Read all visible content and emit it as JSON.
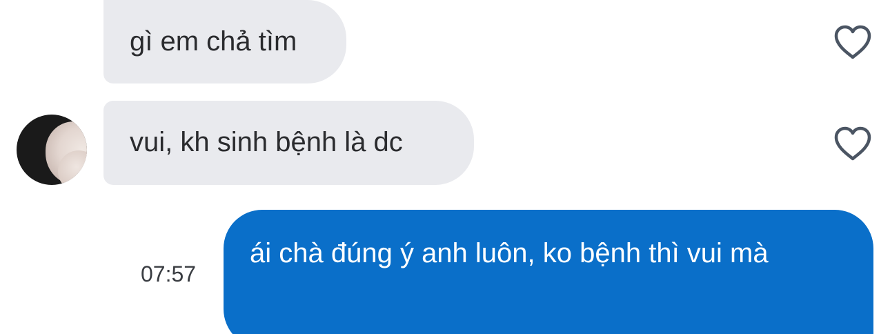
{
  "messages": [
    {
      "sender": "other",
      "text": "gì em chả tìm",
      "liked": false
    },
    {
      "sender": "other",
      "text": "vui, kh sinh bệnh là dc",
      "liked": false
    },
    {
      "sender": "me",
      "text": "ái chà đúng ý anh luôn, ko bệnh thì vui mà",
      "time": "07:57"
    }
  ],
  "icons": {
    "like": "heart-outline-icon",
    "avatar": "contact-avatar"
  },
  "colors": {
    "incoming_bubble": "#e9eaee",
    "outgoing_bubble": "#0a6fc9",
    "heart_stroke": "#4b5563"
  }
}
